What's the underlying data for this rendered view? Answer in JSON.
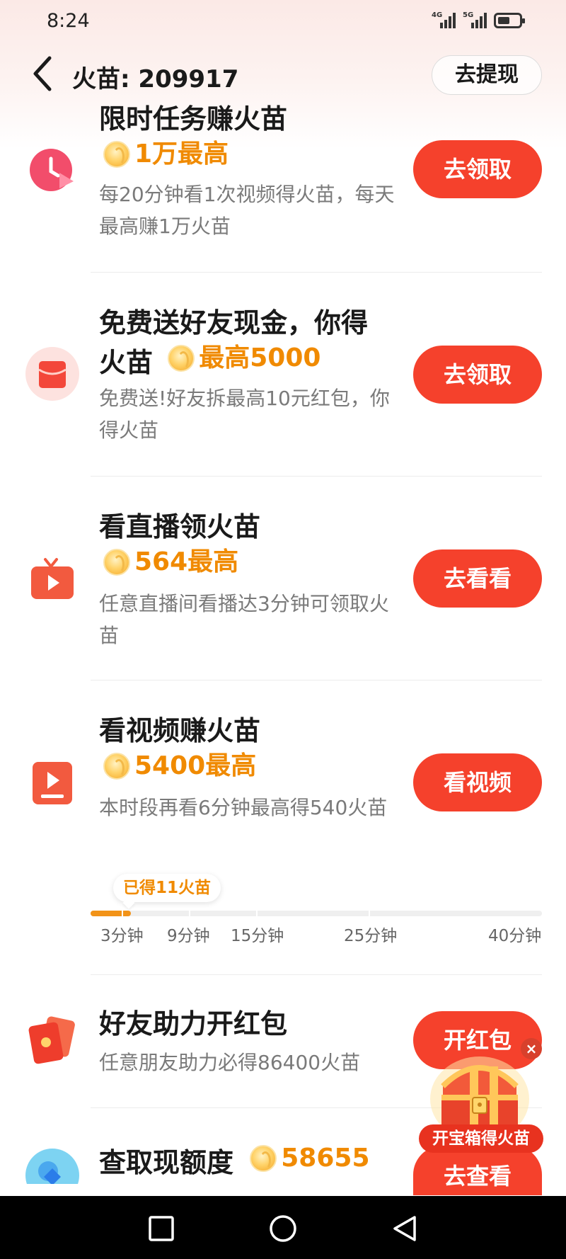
{
  "status_bar": {
    "time": "8:24",
    "signal_1_tag": "4G",
    "signal_2_tag": "5G",
    "icons": [
      "signal-icon",
      "signal-icon",
      "battery-icon"
    ]
  },
  "header": {
    "title": "火苗: 209917",
    "withdraw_label": "去提现",
    "back_icon": "chevron-left-icon"
  },
  "tasks": [
    {
      "icon": "clock-play-icon",
      "title": "限时任务赚火苗",
      "reward": "1万最高",
      "desc": "每20分钟看1次视频得火苗，每天最高赚1万火苗",
      "button": "去领取"
    },
    {
      "icon": "red-envelope-icon",
      "title_line1": "免费送好友现金，你得",
      "title_line2": "火苗",
      "reward": "最高5000",
      "desc": "免费送!好友拆最高10元红包，你得火苗",
      "button": "去领取"
    },
    {
      "icon": "live-tv-icon",
      "title": "看直播领火苗",
      "reward": "564最高",
      "desc": "任意直播间看播达3分钟可领取火苗",
      "button": "去看看"
    },
    {
      "icon": "video-play-icon",
      "title": "看视频赚火苗",
      "reward": "5400最高",
      "desc": "本时段再看6分钟最高得540火苗",
      "button": "看视频"
    },
    {
      "icon": "red-packets-icon",
      "title": "好友助力开红包",
      "desc": "任意朋友助力必得86400火苗",
      "button": "开红包"
    },
    {
      "icon": "diamond-icon",
      "title": "查取现额度",
      "reward": "58655",
      "button": "去查看"
    }
  ],
  "progress": {
    "earned_label": "已得11火苗",
    "fraction": 0.09,
    "labels": [
      "3分钟",
      "9分钟",
      "15分钟",
      "25分钟",
      "40分钟"
    ]
  },
  "treasure": {
    "label": "开宝箱得火苗",
    "close": "×",
    "icon": "treasure-chest-icon"
  },
  "nav": {
    "icons": [
      "recent-apps-icon",
      "home-icon",
      "back-icon"
    ]
  },
  "colors": {
    "accent": "#f5412c",
    "reward": "#f08a00",
    "desc": "#7a7a7a"
  }
}
